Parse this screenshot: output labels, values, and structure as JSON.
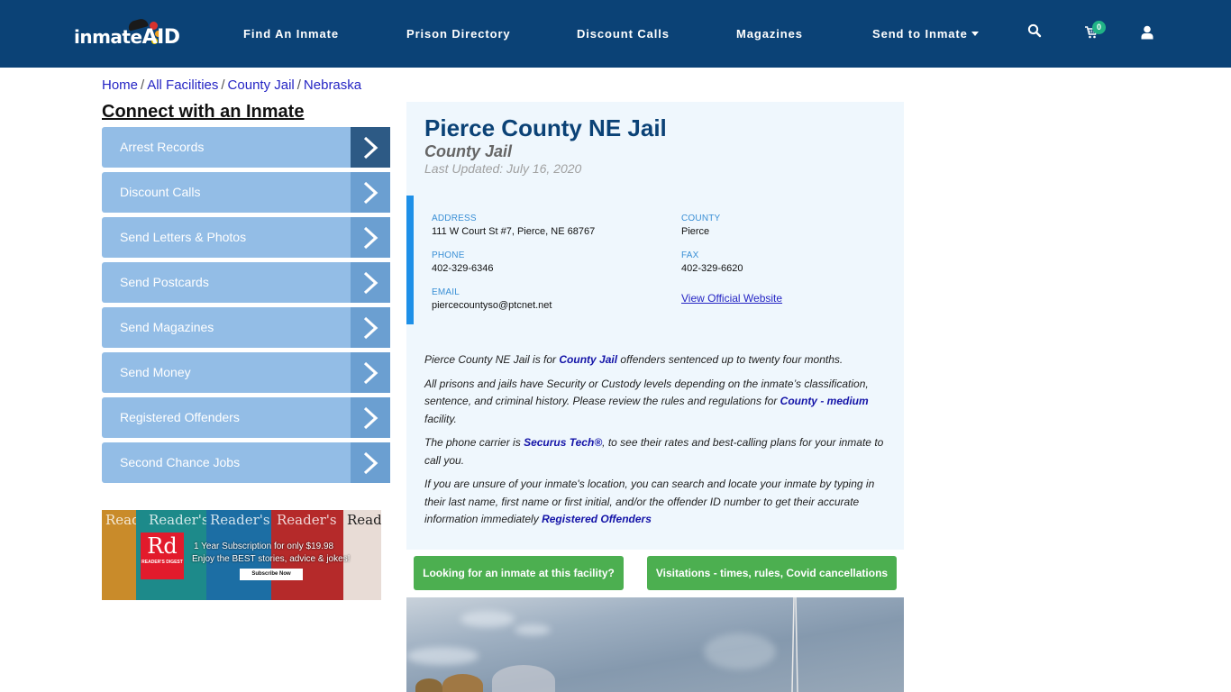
{
  "header": {
    "logo_text": "inmate",
    "logo_text_accent": "AID",
    "nav": [
      {
        "label": "Find An Inmate"
      },
      {
        "label": "Prison Directory"
      },
      {
        "label": "Discount Calls"
      },
      {
        "label": "Magazines"
      },
      {
        "label": "Send to Inmate",
        "has_dropdown": true
      }
    ],
    "icons": {
      "search": "search-icon",
      "cart": "cart-icon",
      "user": "user-icon"
    },
    "cart_count": "0",
    "colors": {
      "navbar_bg": "#0b4276",
      "badge_bg": "#21b386"
    }
  },
  "breadcrumb": [
    {
      "label": "Home"
    },
    {
      "label": "All Facilities"
    },
    {
      "label": "County Jail"
    },
    {
      "label": "Nebraska"
    }
  ],
  "breadcrumb_separator": "/",
  "sidebar": {
    "title": "Connect with an Inmate",
    "items": [
      {
        "label": "Arrest Records",
        "active": true
      },
      {
        "label": "Discount Calls"
      },
      {
        "label": "Send Letters & Photos"
      },
      {
        "label": "Send Postcards"
      },
      {
        "label": "Send Magazines"
      },
      {
        "label": "Send Money"
      },
      {
        "label": "Registered Offenders"
      },
      {
        "label": "Second Chance Jobs"
      }
    ],
    "ad": {
      "masthead": "Reader's",
      "masthead_sub": "digest",
      "logo": "Rd",
      "logo_name": "READER'S DIGEST",
      "line1": "1 Year Subscription for only $19.98",
      "line2": "Enjoy the BEST stories, advice & jokes!",
      "button": "Subscribe Now"
    }
  },
  "facility": {
    "name": "Pierce County NE Jail",
    "type": "County Jail",
    "last_updated": "Last Updated: July 16, 2020",
    "address_label": "ADDRESS",
    "address": "111 W Court St #7, Pierce, NE 68767",
    "county_label": "COUNTY",
    "county": "Pierce",
    "phone_label": "PHONE",
    "phone": "402-329-6346",
    "fax_label": "FAX",
    "fax": "402-329-6620",
    "email_label": "EMAIL",
    "email": "piercecountyso@ptcnet.net",
    "website_link": "View Official Website"
  },
  "description": {
    "p1_pre": "Pierce County NE Jail is for ",
    "p1_link": "County Jail",
    "p1_post": " offenders sentenced up to twenty four months.",
    "p2_pre": "All prisons and jails have Security or Custody levels depending on the inmate’s classification, sentence, and criminal history. Please review the rules and regulations for ",
    "p2_link": "County - medium",
    "p2_post": " facility.",
    "p3_pre": "The phone carrier is ",
    "p3_link": "Securus Tech®",
    "p3_post": ", to see their rates and best-calling plans for your inmate to call you.",
    "p4_pre": "If you are unsure of your inmate's location, you can search and locate your inmate by typing in their last name, first name or first initial, and/or the offender ID number to get their accurate information immediately ",
    "p4_link": "Registered Offenders"
  },
  "buttons": {
    "looking": "Looking for an inmate at this facility?",
    "visitations": "Visitations - times, rules, Covid cancellations"
  }
}
